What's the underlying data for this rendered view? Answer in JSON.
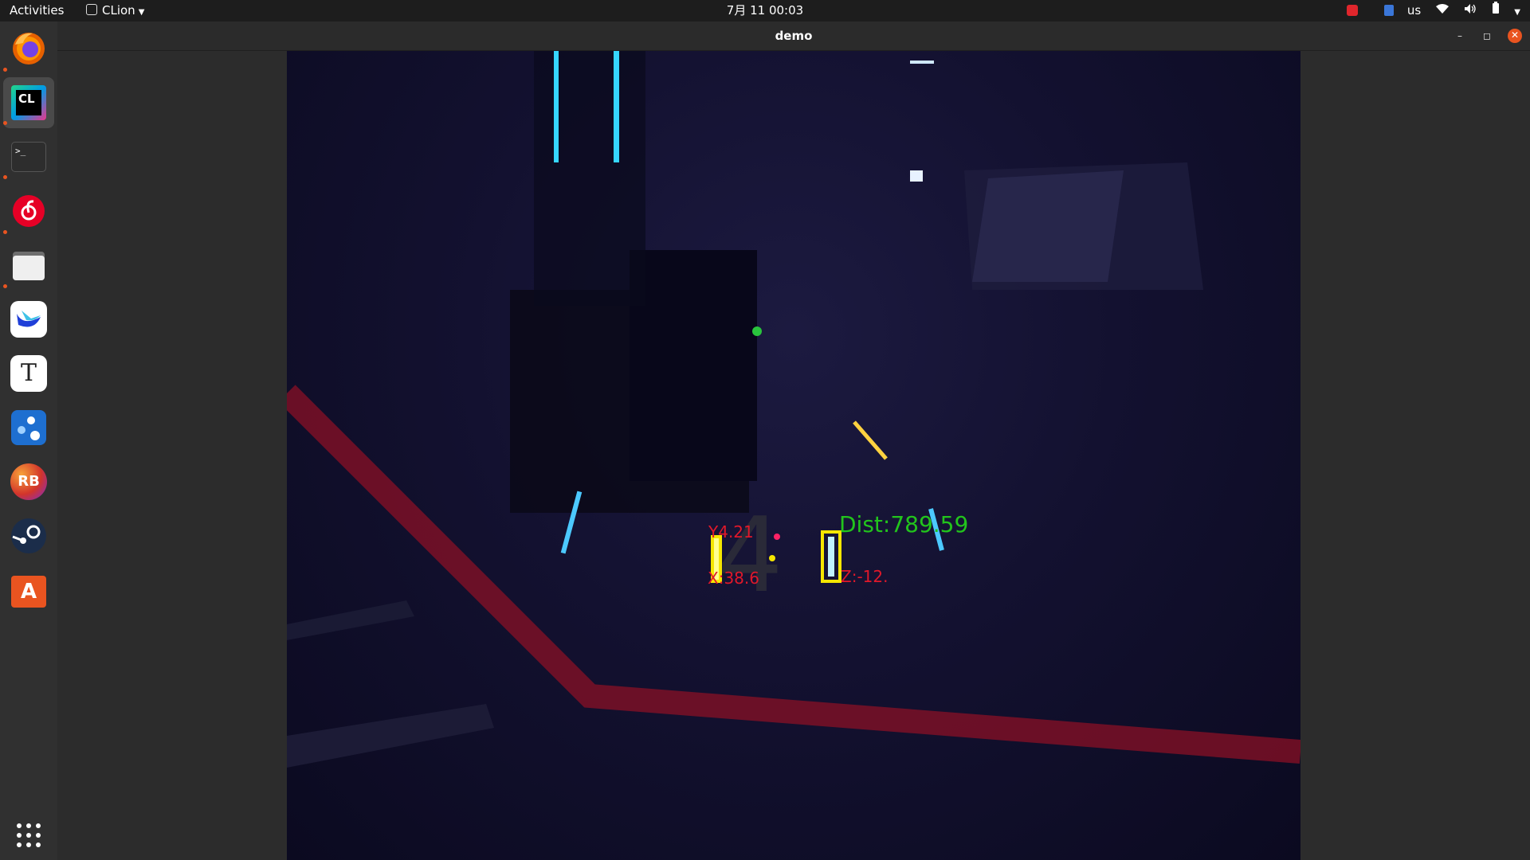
{
  "topbar": {
    "activities": "Activities",
    "app_name": "CLion",
    "clock": "7月 11  00:03",
    "keyboard_layout": "us"
  },
  "window": {
    "title": "demo"
  },
  "dock": {
    "apps": [
      {
        "name": "firefox",
        "running": true
      },
      {
        "name": "clion",
        "label": "CL",
        "running": true,
        "active": true
      },
      {
        "name": "terminal",
        "label": ">_",
        "running": true
      },
      {
        "name": "netease-music",
        "running": true
      },
      {
        "name": "files",
        "running": true
      },
      {
        "name": "feishu",
        "running": false
      },
      {
        "name": "typora",
        "label": "T",
        "running": false
      },
      {
        "name": "ros-app",
        "running": false
      },
      {
        "name": "rustdesk",
        "label": "RB",
        "running": false
      },
      {
        "name": "steam",
        "running": false
      },
      {
        "name": "software-center",
        "label": "A",
        "running": false
      }
    ]
  },
  "overlay": {
    "y_label": "Y4.21",
    "x_label": "X:38.6",
    "z_label": "Z:-12.",
    "dist_label": "Dist:789.59",
    "colors": {
      "red": "#e0182a",
      "green": "#22c41c",
      "yellow": "#f5e600"
    }
  }
}
